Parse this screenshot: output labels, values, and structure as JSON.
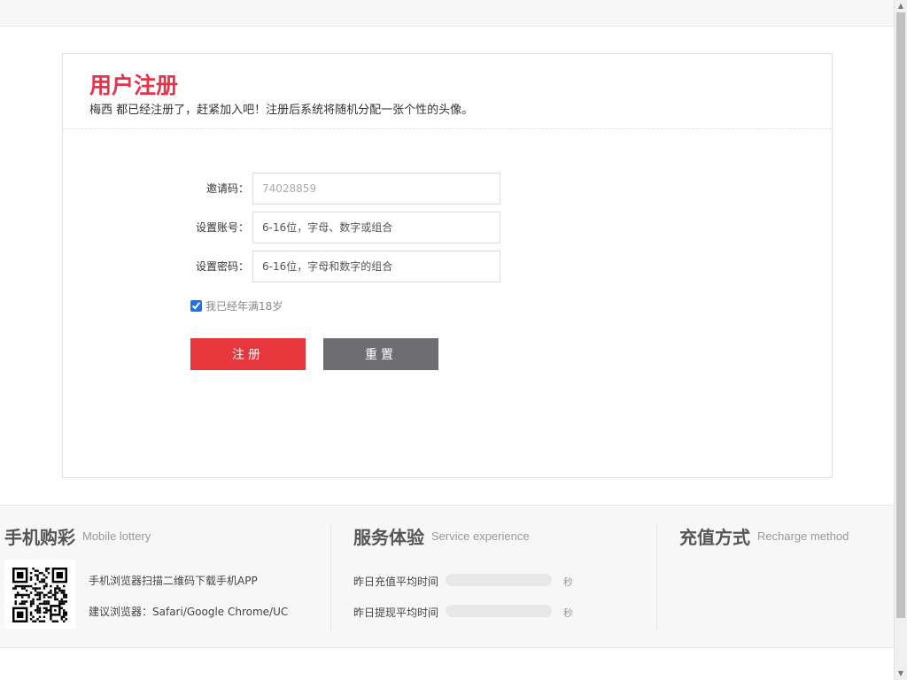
{
  "register": {
    "title": "用户注册",
    "subtitle": "梅西 都已经注册了，赶紧加入吧！注册后系统将随机分配一张个性的头像。"
  },
  "form": {
    "invite_label": "邀请码：",
    "invite_placeholder": "74028859",
    "account_label": "设置账号：",
    "account_placeholder": "6-16位，字母、数字或组合",
    "password_label": "设置密码：",
    "password_placeholder": "6-16位，字母和数字的组合",
    "agree_label": "我已经年满18岁",
    "agree_checked": true,
    "register_button": "注册",
    "reset_button": "重置"
  },
  "footer": {
    "mobile": {
      "title": "手机购彩",
      "title_en": "Mobile lottery",
      "qr_text": "手机浏览器扫描二维码下载手机APP",
      "browser_text": "建议浏览器：Safari/Google Chrome/UC"
    },
    "service": {
      "title": "服务体验",
      "title_en": "Service experience",
      "deposit_label": "昨日充值平均时间",
      "deposit_unit": "秒",
      "deposit_progress": 0,
      "withdraw_label": "昨日提现平均时间",
      "withdraw_unit": "秒",
      "withdraw_progress": 0
    },
    "recharge": {
      "title": "充值方式",
      "title_en": "Recharge method"
    }
  },
  "colors": {
    "accent_red": "#e8314a",
    "register_button": "#e6373d",
    "reset_button": "#6e6e72"
  }
}
